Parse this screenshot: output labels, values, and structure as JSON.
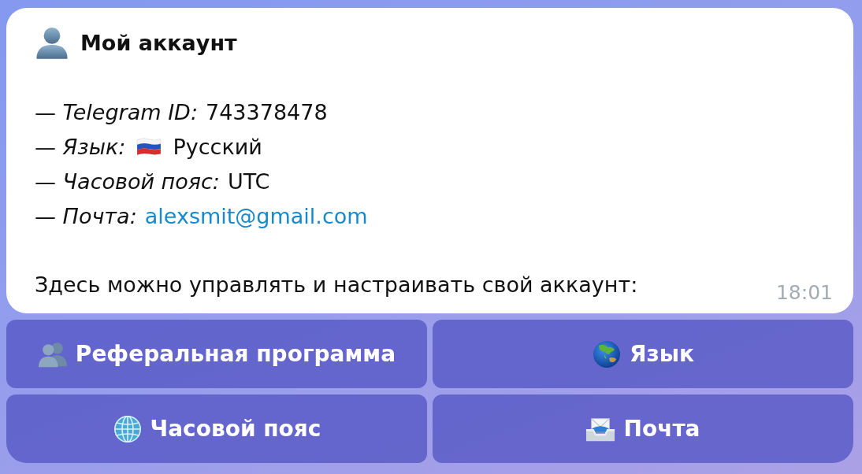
{
  "message": {
    "title": "Мой аккаунт",
    "fields": [
      {
        "kind": "plain",
        "label": "— *Telegram ID:*",
        "value": "743378478"
      },
      {
        "kind": "flagged",
        "label": "— *Язык:*",
        "value": "Русский"
      },
      {
        "kind": "plain",
        "label": "— *Часовой пояс:*",
        "value": "UTC"
      },
      {
        "kind": "link",
        "label": "— *Почта:*",
        "value": "alexsmit@gmail.com"
      }
    ],
    "footer": "Здесь можно управлять и настраивать свой аккаунт:",
    "time": "18:01"
  },
  "keyboard": {
    "rows": [
      {
        "buttons": [
          {
            "label": "Реферальная программа"
          },
          {
            "label": "Язык"
          }
        ]
      },
      {
        "buttons": [
          {
            "label": "Часовой пояс"
          },
          {
            "label": "Почта"
          }
        ]
      }
    ]
  }
}
